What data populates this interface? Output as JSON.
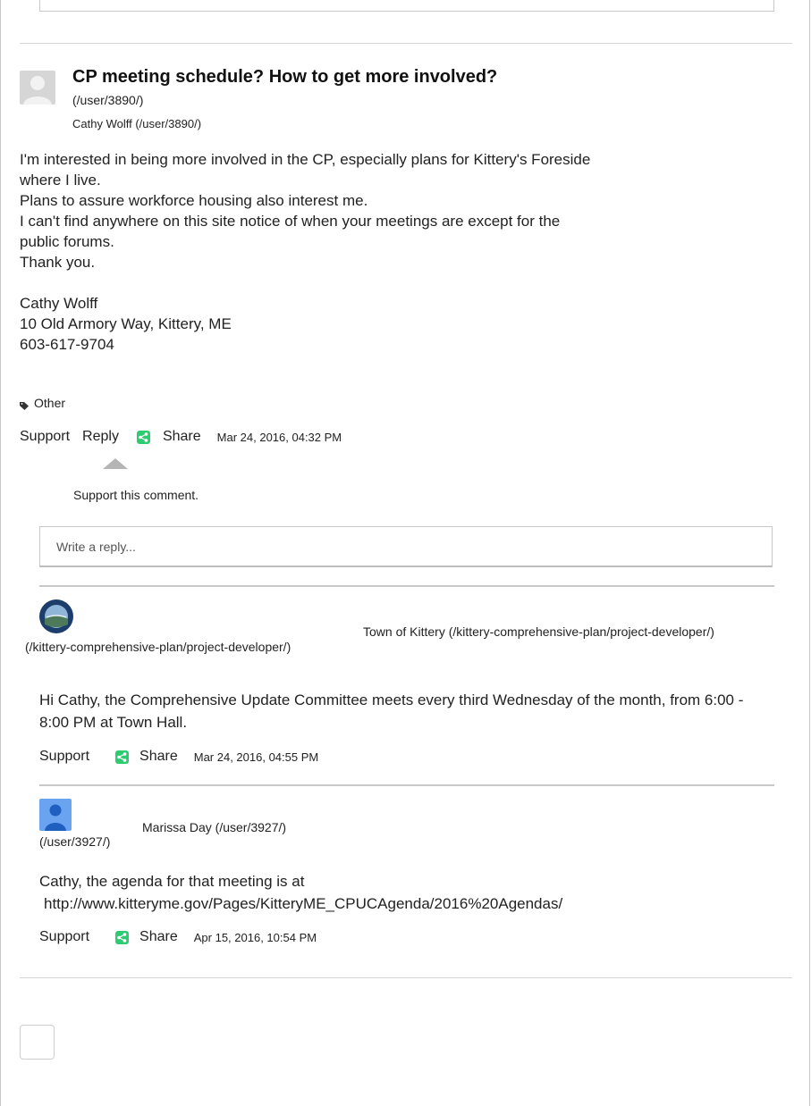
{
  "post": {
    "title": "CP meeting schedule? How to get more involved?",
    "user_link": "(/user/3890/)",
    "author": "Cathy Wolff (/user/3890/)",
    "body_lines": [
      "I'm interested in being more involved in the CP, especially plans for Kittery's Foreside",
      "where I live.",
      "Plans to assure workforce housing also interest me.",
      "I can't find anywhere on this site notice of when your meetings are except for the",
      "public forums.",
      "Thank you."
    ],
    "signature_lines": [
      "Cathy Wolff",
      "10 Old Armory Way, Kittery, ME",
      "603-617-9704"
    ],
    "tag": "Other",
    "tag_icon": "tag-icon",
    "actions": {
      "support": "Support",
      "reply": "Reply",
      "share": "Share",
      "date": "Mar 24, 2016, 04:32 PM"
    },
    "support_hint": "Support this comment.",
    "reply_placeholder": "Write a reply..."
  },
  "replies": [
    {
      "avatar_link": "(/kittery-comprehensive-plan/project-developer/)",
      "author": "Town of Kittery (/kittery-comprehensive-plan/project-developer/)",
      "body": "Hi Cathy, the Comprehensive Update Committee meets every third Wednesday of the month, from 6:00 - 8:00 PM at Town Hall.",
      "support": "Support",
      "share": "Share",
      "date": "Mar 24, 2016, 04:55 PM"
    },
    {
      "avatar_link": "(/user/3927/)",
      "author": "Marissa Day (/user/3927/)",
      "body_line1": "Cathy, the agenda for that meeting is at",
      "body_line2": "http://www.kitteryme.gov/Pages/KitteryME_CPUCAgenda/2016%20Agendas/",
      "support": "Support",
      "share": "Share",
      "date": "Apr 15, 2016, 10:54 PM"
    }
  ],
  "colors": {
    "share_icon": "#2ecc71",
    "border": "#c8c8c8",
    "user_avatar": "#6aa3f0",
    "town_seal": "#1d3d6b"
  }
}
